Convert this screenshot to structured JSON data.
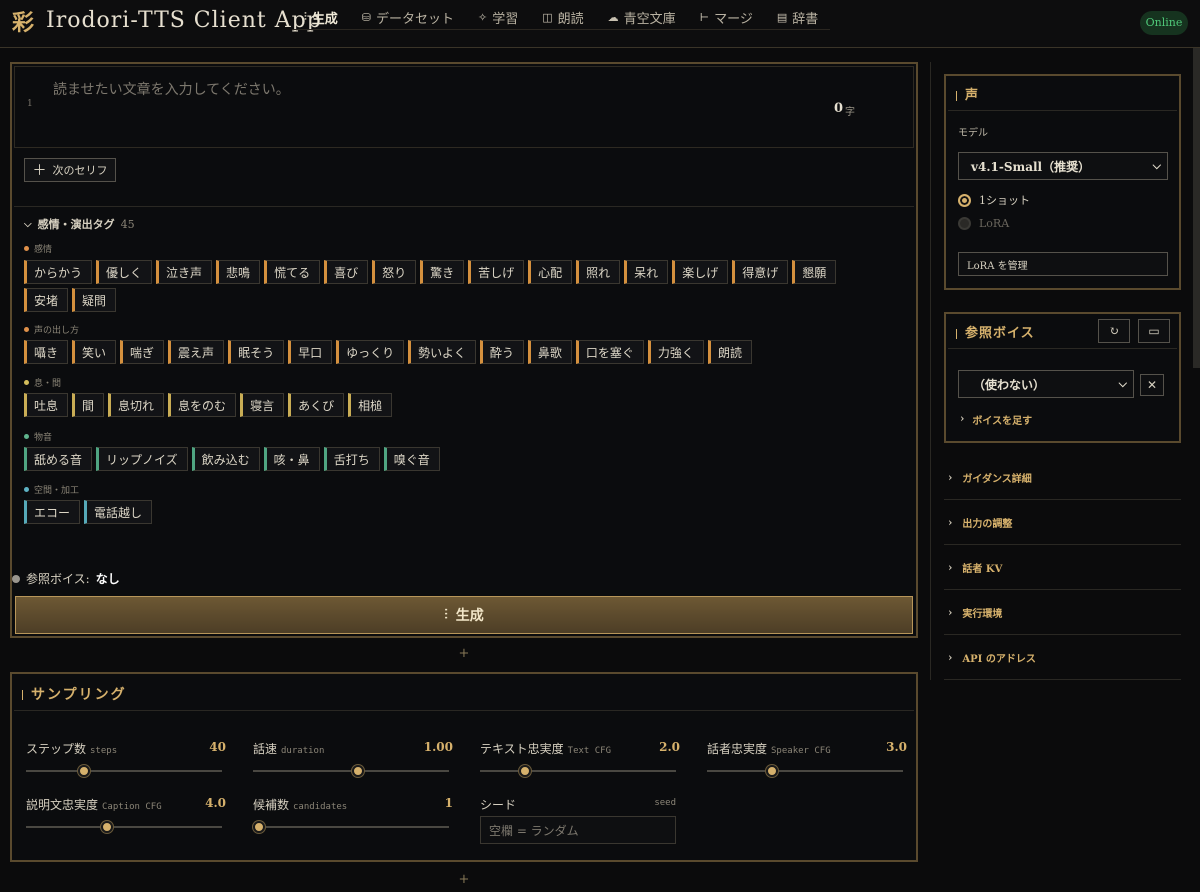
{
  "header": {
    "logo_glyph": "彩",
    "title": "Irodori-TTS Client App",
    "status": "Online",
    "tabs": [
      {
        "label": "生成",
        "icon": "waveform-icon",
        "glyph": "⫶",
        "active": true
      },
      {
        "label": "データセット",
        "icon": "database-icon",
        "glyph": "⛁",
        "active": false
      },
      {
        "label": "学習",
        "icon": "sparkle-icon",
        "glyph": "✧",
        "active": false
      },
      {
        "label": "朗読",
        "icon": "book-icon",
        "glyph": "◫",
        "active": false
      },
      {
        "label": "青空文庫",
        "icon": "cloud-icon",
        "glyph": "☁",
        "active": false
      },
      {
        "label": "マージ",
        "icon": "merge-icon",
        "glyph": "⊢",
        "active": false
      },
      {
        "label": "辞書",
        "icon": "dictionary-icon",
        "glyph": "▤",
        "active": false
      }
    ]
  },
  "editor": {
    "line_number": "1",
    "placeholder": "読ませたい文章を入力してください。",
    "char_count": "0",
    "char_unit": "字",
    "next_line_label": "次のセリフ"
  },
  "tags": {
    "title": "感情・演出タグ",
    "count": "45",
    "groups": [
      {
        "label": "感情",
        "color": "#e0914a",
        "items": [
          "からかう",
          "優しく",
          "泣き声",
          "悲鳴",
          "慌てる",
          "喜び",
          "怒り",
          "驚き",
          "苦しげ",
          "心配",
          "照れ",
          "呆れ",
          "楽しげ",
          "得意げ",
          "懇願",
          "安堵",
          "疑問"
        ]
      },
      {
        "label": "声の出し方",
        "color": "#e0914a",
        "items": [
          "囁き",
          "笑い",
          "喘ぎ",
          "震え声",
          "眠そう",
          "早口",
          "ゆっくり",
          "勢いよく",
          "酔う",
          "鼻歌",
          "口を塞ぐ",
          "力強く",
          "朗読"
        ]
      },
      {
        "label": "息・間",
        "color": "#d4bd5c",
        "items": [
          "吐息",
          "間",
          "息切れ",
          "息をのむ",
          "寝言",
          "あくび",
          "相槌"
        ]
      },
      {
        "label": "物音",
        "color": "#5fb48d",
        "items": [
          "舐める音",
          "リップノイズ",
          "飲み込む",
          "咳・鼻",
          "舌打ち",
          "嗅ぐ音"
        ]
      },
      {
        "label": "空間・加工",
        "color": "#5eb3c4",
        "items": [
          "エコー",
          "電話越し"
        ]
      }
    ]
  },
  "reference": {
    "label": "参照ボイス:",
    "value": "なし"
  },
  "generate": {
    "label": "生成"
  },
  "sampling": {
    "title": "サンプリング",
    "params": [
      {
        "label": "ステップ数",
        "sub": "steps",
        "value": "40",
        "fraction": 0.28
      },
      {
        "label": "話速",
        "sub": "duration",
        "value": "1.00",
        "fraction": 0.54
      },
      {
        "label": "テキスト忠実度",
        "sub": "Text CFG",
        "value": "2.0",
        "fraction": 0.21
      },
      {
        "label": "話者忠実度",
        "sub": "Speaker CFG",
        "value": "3.0",
        "fraction": 0.32
      },
      {
        "label": "説明文忠実度",
        "sub": "Caption CFG",
        "value": "4.0",
        "fraction": 0.41
      },
      {
        "label": "候補数",
        "sub": "candidates",
        "value": "1",
        "fraction": 0.0
      }
    ],
    "seed": {
      "label": "シード",
      "sub": "seed",
      "placeholder": "空欄 = ランダム"
    }
  },
  "voice_panel": {
    "title": "声",
    "model_label": "モデル",
    "model_value": "v4.1-Small（推奨）",
    "option_1shot": "1ショット",
    "option_lora": "LoRA",
    "lora_manage": "LoRA を管理"
  },
  "ref_panel": {
    "title": "参照ボイス",
    "select_value": "（使わない）",
    "add_voice": "ボイスを足す"
  },
  "accordions": [
    "ガイダンス詳細",
    "出力の調整",
    "話者 KV",
    "実行環境",
    "API のアドレス"
  ],
  "colors": {
    "accent": "#d6b16c",
    "online": "#4fc778",
    "border": "#5a4a2e"
  }
}
